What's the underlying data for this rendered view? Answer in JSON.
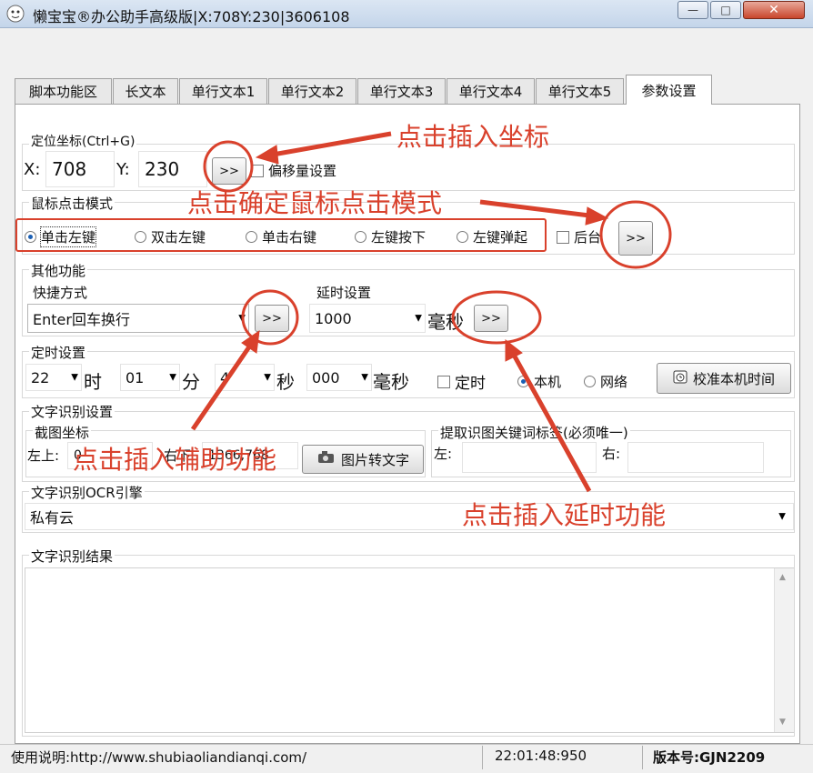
{
  "window": {
    "title": "懒宝宝®办公助手高级版|X:708Y:230|3606108",
    "minimize_glyph": "—",
    "maximize_glyph": "□",
    "close_glyph": "✕"
  },
  "tabs": [
    {
      "label": "脚本功能区"
    },
    {
      "label": "长文本"
    },
    {
      "label": "单行文本1"
    },
    {
      "label": "单行文本2"
    },
    {
      "label": "单行文本3"
    },
    {
      "label": "单行文本4"
    },
    {
      "label": "单行文本5"
    },
    {
      "label": "参数设置",
      "active": true
    }
  ],
  "locate": {
    "group_label": "定位坐标(Ctrl+G)",
    "x_label": "X:",
    "x_value": "708",
    "y_label": "Y:",
    "y_value": "230",
    "insert_button": ">>",
    "offset_label": "偏移量设置"
  },
  "click_mode": {
    "group_label": "鼠标点击模式",
    "options": [
      {
        "label": "单击左键",
        "selected": true
      },
      {
        "label": "双击左键",
        "selected": false
      },
      {
        "label": "单击右键",
        "selected": false
      },
      {
        "label": "左键按下",
        "selected": false
      },
      {
        "label": "左键弹起",
        "selected": false
      }
    ],
    "background_label": "后台",
    "insert_button": ">>"
  },
  "other": {
    "group_label": "其他功能",
    "shortcut_label": "快捷方式",
    "shortcut_value": "Enter回车换行",
    "shortcut_button": ">>",
    "delay_label": "延时设置",
    "delay_value": "1000",
    "delay_unit": "毫秒",
    "delay_button": ">>"
  },
  "timer": {
    "group_label": "定时设置",
    "hour": "22",
    "hour_unit": "时",
    "minute": "01",
    "minute_unit": "分",
    "second": "4",
    "second_unit": "秒",
    "ms": "000",
    "ms_unit": "毫秒",
    "timer_check_label": "定时",
    "local_label": "本机",
    "network_label": "网络",
    "calibrate_button": "校准本机时间"
  },
  "ocr": {
    "group_label": "文字识别设置",
    "capture_label": "截图坐标",
    "top_left_label": "左上:",
    "top_left_value": "0",
    "bottom_right_label": "右下",
    "bottom_right_value": "1366,768",
    "image_to_text_button": "图片转文字",
    "keyword_label": "提取识图关键词标签(必须唯一)",
    "left_label": "左:",
    "right_label": "右:"
  },
  "engine": {
    "group_label": "文字识别OCR引擎",
    "value": "私有云"
  },
  "result": {
    "group_label": "文字识别结果"
  },
  "status": {
    "help": "使用说明:http://www.shubiaoliandianqi.com/",
    "time": "22:01:48:950",
    "version": "版本号:GJN2209"
  },
  "annotations": {
    "insert_coord": "点击插入坐标",
    "click_mode": "点击确定鼠标点击模式",
    "aux": "点击插入辅助功能",
    "delay": "点击插入延时功能",
    "color": "#d9412c"
  }
}
